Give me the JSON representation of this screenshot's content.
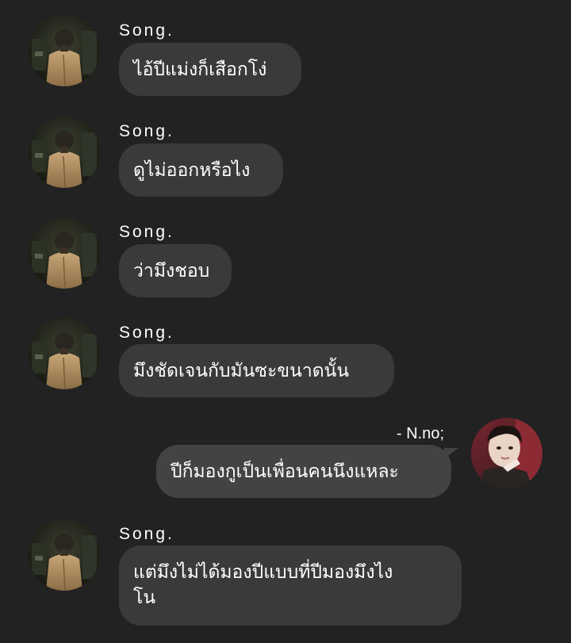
{
  "messages": [
    {
      "sender": "Song.",
      "text": "ไอ้ปีแม่งก็เสือกโง่",
      "direction": "incoming"
    },
    {
      "sender": "Song.",
      "text": "ดูไม่ออกหรือไง",
      "direction": "incoming"
    },
    {
      "sender": "Song.",
      "text": "ว่ามึงชอบ",
      "direction": "incoming"
    },
    {
      "sender": "Song.",
      "text": "มึงชัดเจนกับมันซะขนาดนั้น",
      "direction": "incoming"
    },
    {
      "sender": "- N.no;",
      "text": "ปีก็มองกูเป็นเพื่อนคนนึงแหละ",
      "direction": "outgoing"
    },
    {
      "sender": "Song.",
      "text_lines": [
        "แต่มึงไม่ได้มองปีแบบที่ปีมองมึงไง",
        "โน"
      ],
      "direction": "incoming"
    }
  ],
  "colors": {
    "background": "#222222",
    "bubble_incoming": "#3a3a3a",
    "bubble_outgoing": "#434343",
    "text": "#ffffff"
  }
}
